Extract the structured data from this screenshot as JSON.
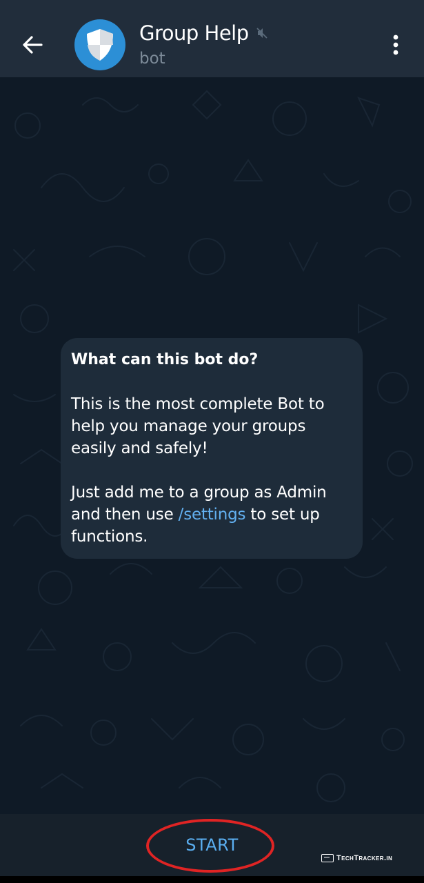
{
  "header": {
    "title": "Group Help",
    "subtitle": "bot",
    "avatar_icon": "shield-icon",
    "back_icon": "arrow-left-icon",
    "menu_icon": "more-vertical-icon",
    "mute_icon": "muted-speaker-icon"
  },
  "message": {
    "title": "What can this bot do?",
    "paragraph1": "This is the most complete Bot to help you manage your groups easily and safely!",
    "paragraph2_before": "Just add me to a group as Admin and then use ",
    "paragraph2_command": "/settings",
    "paragraph2_after": " to set up functions."
  },
  "bottom": {
    "start_label": "START"
  },
  "watermark": {
    "text": "TechTracker.in"
  },
  "colors": {
    "header_bg": "#212d3b",
    "chat_bg": "#0f1a26",
    "bubble_bg": "#1e2c3a",
    "link": "#62b0f0",
    "start": "#5aaef0",
    "annotation": "#e02424",
    "avatar_bg": "#2c8fd6"
  }
}
